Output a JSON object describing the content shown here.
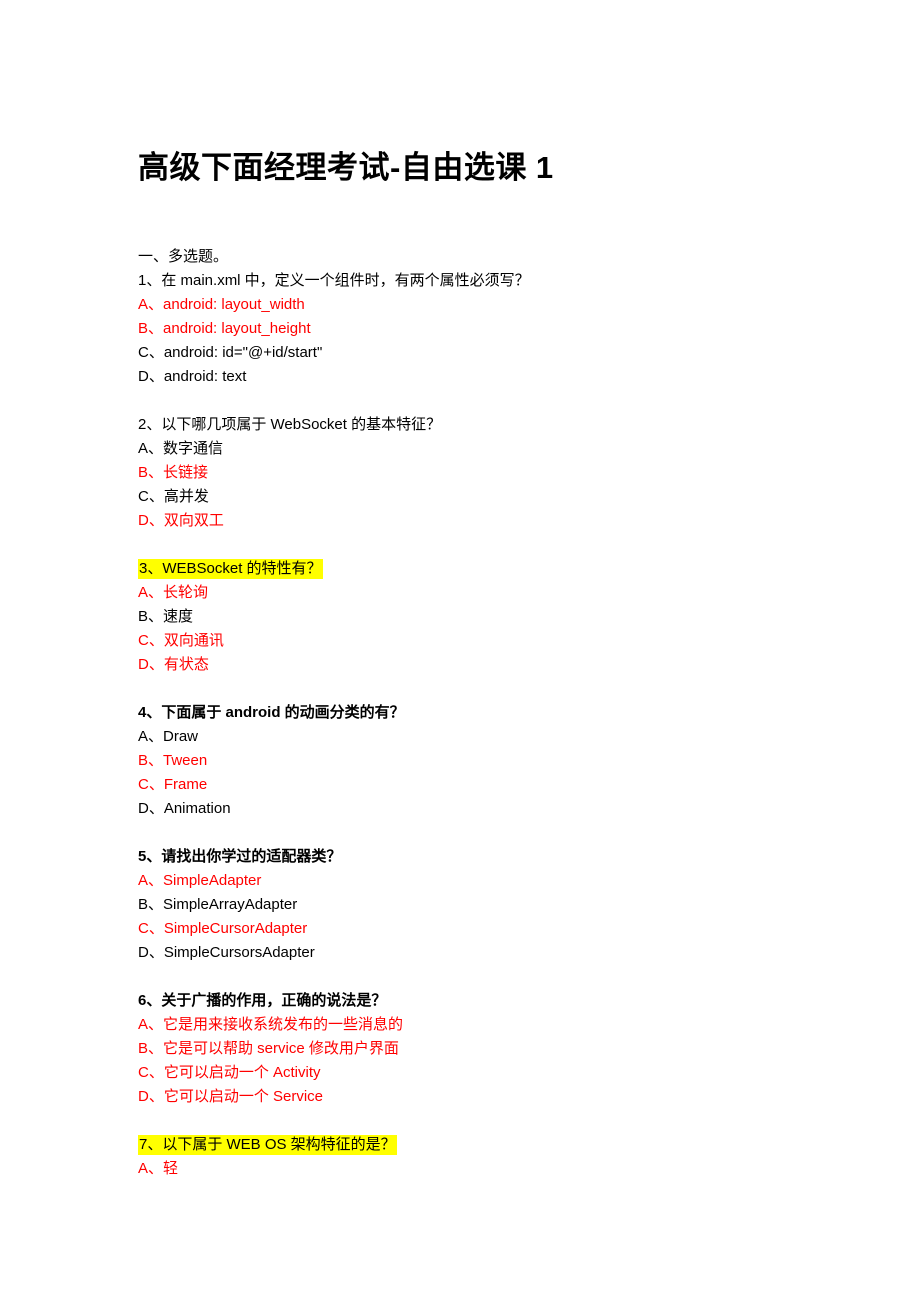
{
  "document": {
    "title": "高级下面经理考试-自由选课 1",
    "section_heading": "一、多选题。",
    "colors": {
      "correct_answer": "#ff0000",
      "highlight": "#ffff00",
      "text": "#000000"
    }
  },
  "questions": [
    {
      "stem": "1、在 main.xml 中，定义一个组件时，有两个属性必须写？",
      "bold": false,
      "highlighted": false,
      "options": [
        {
          "label": "A、android: layout_width",
          "correct": true
        },
        {
          "label": "B、android: layout_height",
          "correct": true
        },
        {
          "label": "C、android: id=\"@+id/start\"",
          "correct": false
        },
        {
          "label": "D、android: text",
          "correct": false
        }
      ]
    },
    {
      "stem": "2、以下哪几项属于 WebSocket 的基本特征？",
      "bold": false,
      "highlighted": false,
      "options": [
        {
          "label": "A、数字通信",
          "correct": false
        },
        {
          "label": "B、长链接",
          "correct": true
        },
        {
          "label": "C、高并发",
          "correct": false
        },
        {
          "label": "D、双向双工",
          "correct": true
        }
      ]
    },
    {
      "stem": "3、WEBSocket 的特性有？",
      "bold": false,
      "highlighted": true,
      "options": [
        {
          "label": "A、长轮询",
          "correct": true
        },
        {
          "label": "B、速度",
          "correct": false
        },
        {
          "label": "C、双向通讯",
          "correct": true
        },
        {
          "label": "D、有状态",
          "correct": true
        }
      ]
    },
    {
      "stem": "4、下面属于 android 的动画分类的有？",
      "bold": true,
      "highlighted": false,
      "options": [
        {
          "label": "A、Draw",
          "correct": false
        },
        {
          "label": "B、Tween",
          "correct": true
        },
        {
          "label": "C、Frame",
          "correct": true
        },
        {
          "label": "D、Animation",
          "correct": false
        }
      ]
    },
    {
      "stem": "5、请找出你学过的适配器类？",
      "bold": true,
      "highlighted": false,
      "options": [
        {
          "label": "A、SimpleAdapter",
          "correct": true
        },
        {
          "label": "B、SimpleArrayAdapter",
          "correct": false
        },
        {
          "label": "C、SimpleCursorAdapter",
          "correct": true
        },
        {
          "label": "D、SimpleCursorsAdapter",
          "correct": false
        }
      ]
    },
    {
      "stem": "6、关于广播的作用，正确的说法是？",
      "bold": true,
      "highlighted": false,
      "options": [
        {
          "label": "A、它是用来接收系统发布的一些消息的",
          "correct": true
        },
        {
          "label": "B、它是可以帮助 service 修改用户界面",
          "correct": true
        },
        {
          "label": "C、它可以启动一个 Activity",
          "correct": true
        },
        {
          "label": "D、它可以启动一个 Service",
          "correct": true
        }
      ]
    },
    {
      "stem": "7、以下属于 WEB OS 架构特征的是？",
      "bold": false,
      "highlighted": true,
      "options": [
        {
          "label": "A、轻",
          "correct": true
        }
      ]
    }
  ]
}
